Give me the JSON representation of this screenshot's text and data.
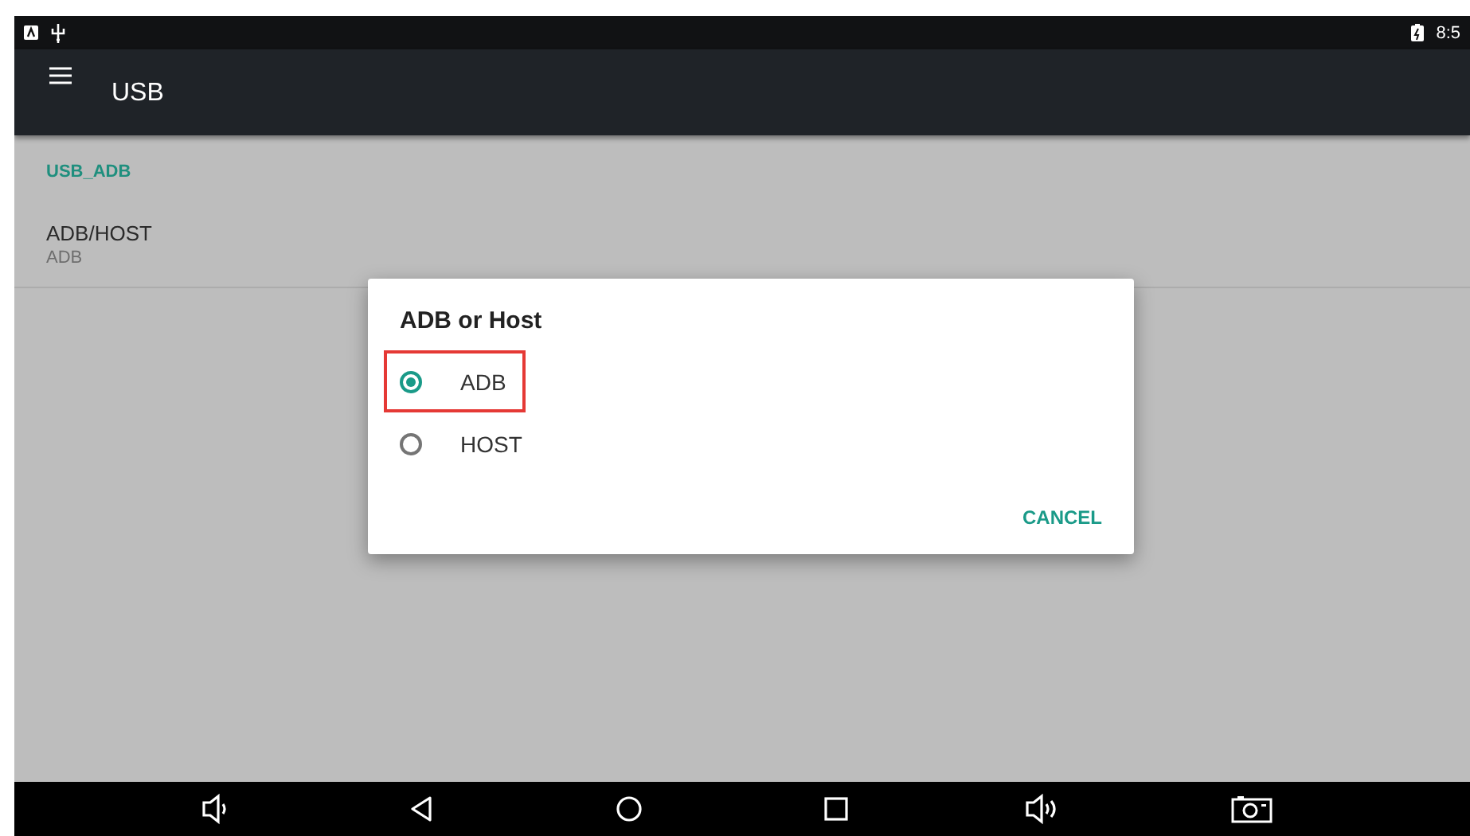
{
  "status_bar": {
    "time": "8:5"
  },
  "app_bar": {
    "title": "USB"
  },
  "preferences": {
    "category": "USB_ADB",
    "items": [
      {
        "title": "ADB/HOST",
        "summary": "ADB"
      }
    ]
  },
  "dialog": {
    "title": "ADB or Host",
    "options": [
      {
        "label": "ADB",
        "selected": true,
        "highlighted": true
      },
      {
        "label": "HOST",
        "selected": false,
        "highlighted": false
      }
    ],
    "buttons": [
      "CANCEL"
    ]
  },
  "nav_bar": {
    "buttons": [
      {
        "kind": "volume-down"
      },
      {
        "kind": "back"
      },
      {
        "kind": "home"
      },
      {
        "kind": "recents"
      },
      {
        "kind": "volume-up"
      },
      {
        "kind": "screenshot"
      }
    ]
  }
}
